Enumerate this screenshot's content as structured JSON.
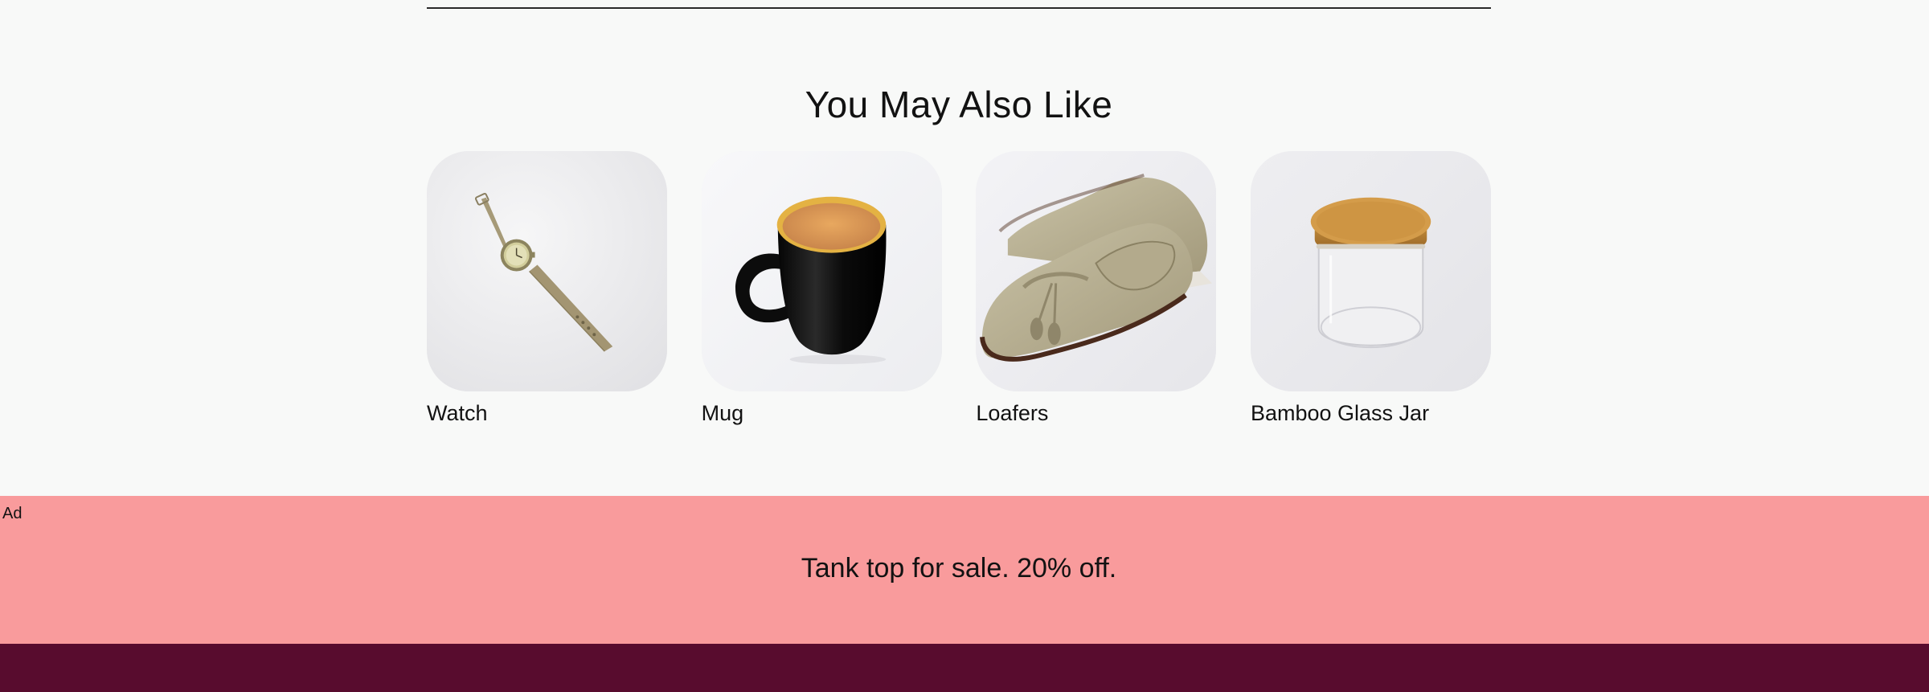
{
  "recommendations": {
    "title": "You May Also Like",
    "products": [
      {
        "name": "Watch",
        "image": "watch-image"
      },
      {
        "name": "Mug",
        "image": "mug-image"
      },
      {
        "name": "Loafers",
        "image": "loafers-image"
      },
      {
        "name": "Bamboo Glass Jar",
        "image": "jar-image"
      }
    ]
  },
  "ad": {
    "label": "Ad",
    "text": "Tank top for sale. 20% off."
  },
  "colors": {
    "page_background": "#f8f9f8",
    "ad_background": "#f99b9c",
    "footer_background": "#580c2e"
  }
}
